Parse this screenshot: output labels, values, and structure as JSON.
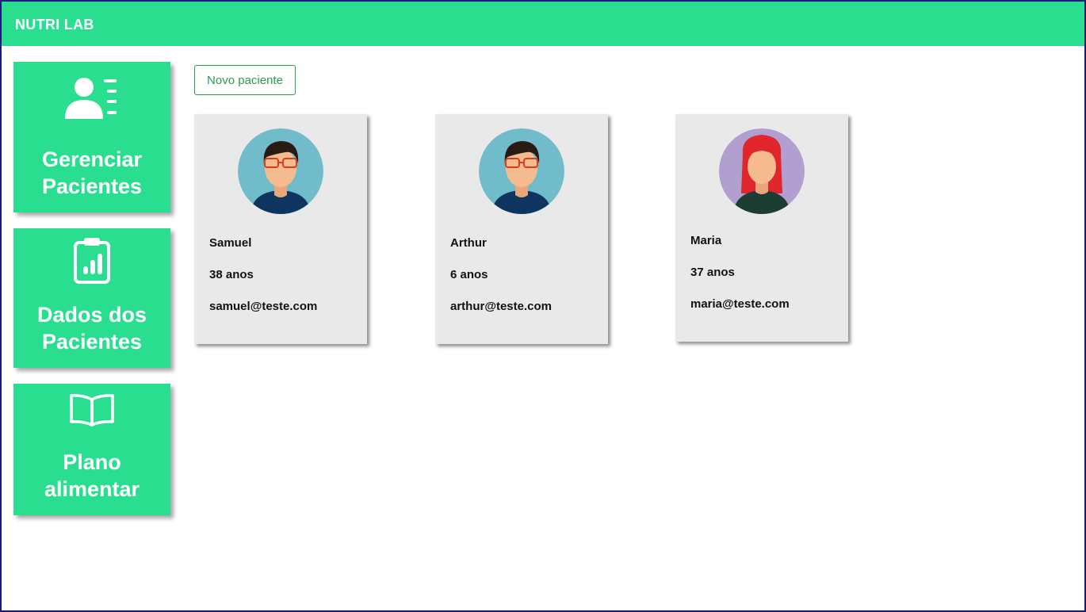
{
  "app": {
    "title": "NUTRI LAB"
  },
  "sidebar": {
    "items": [
      {
        "line1": "Gerenciar",
        "line2": "Pacientes",
        "icon": "user-list-icon"
      },
      {
        "line1": "Dados dos",
        "line2": "Pacientes",
        "icon": "clipboard-chart-icon"
      },
      {
        "line1": "Plano",
        "line2": "alimentar",
        "icon": "open-book-icon"
      }
    ]
  },
  "main": {
    "new_patient_label": "Novo paciente",
    "patients": [
      {
        "name": "Samuel",
        "age": "38 anos",
        "email": "samuel@teste.com",
        "avatar": "male-avatar-icon"
      },
      {
        "name": "Arthur",
        "age": "6 anos",
        "email": "arthur@teste.com",
        "avatar": "male-avatar-icon"
      },
      {
        "name": "Maria",
        "age": "37 anos",
        "email": "maria@teste.com",
        "avatar": "female-avatar-icon"
      }
    ]
  },
  "colors": {
    "accent": "#29df8f",
    "card_bg": "#e9e9e9",
    "button_text": "#2e9b4f"
  }
}
